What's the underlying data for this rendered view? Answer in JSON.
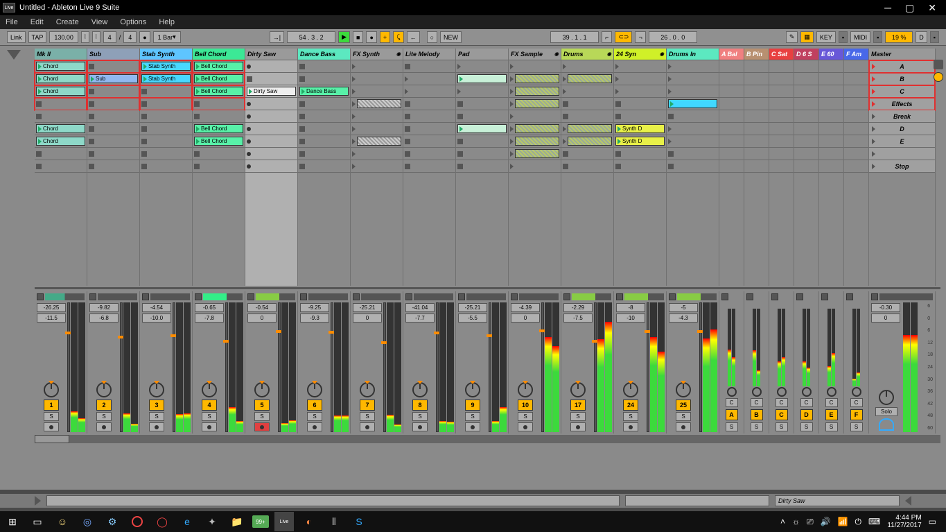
{
  "window": {
    "app_badge": "Live",
    "title": "Untitled - Ableton Live 9 Suite"
  },
  "menu": [
    "File",
    "Edit",
    "Create",
    "View",
    "Options",
    "Help"
  ],
  "transport": {
    "link": "Link",
    "tap": "TAP",
    "tempo": "130.00",
    "sig_num": "4",
    "sig_den": "4",
    "bar_quant": "1 Bar",
    "position": "54 . 3 . 2",
    "new": "NEW",
    "loop_pos": "39 . 1 . 1",
    "loop_len": "26 . 0 . 0",
    "key": "KEY",
    "midi": "MIDI",
    "cpu": "19 %",
    "d": "D"
  },
  "tracks": [
    {
      "name": "Mk II",
      "color": "#7ab0a8",
      "peak": "-26.25",
      "gain": "-11.5",
      "num": "1"
    },
    {
      "name": "Sub",
      "color": "#8ea0b8",
      "peak": "-9.82",
      "gain": "-6.8",
      "num": "2"
    },
    {
      "name": "Stab Synth",
      "color": "#5ec5ff",
      "peak": "-4.54",
      "gain": "-10.0",
      "num": "3"
    },
    {
      "name": "Bell Chord",
      "color": "#3ce896",
      "peak": "-0.65",
      "gain": "-7.8",
      "num": "4"
    },
    {
      "name": "Dirty Saw",
      "color": "#9a9a9a",
      "peak": "-0.54",
      "gain": "0",
      "num": "5"
    },
    {
      "name": "Dance Bass",
      "color": "#5ce8c0",
      "peak": "-9.25",
      "gain": "-9.3",
      "num": "6"
    },
    {
      "name": "FX Synth",
      "color": "#9a9a9a",
      "peak": "-25.21",
      "gain": "0",
      "num": "7"
    },
    {
      "name": "Lite Melody",
      "color": "#9a9a9a",
      "peak": "-41.04",
      "gain": "-7.7",
      "num": "8"
    },
    {
      "name": "Pad",
      "color": "#9a9a9a",
      "peak": "-25.21",
      "gain": "-5.5",
      "num": "9"
    },
    {
      "name": "FX Sample",
      "color": "#9a9a9a",
      "peak": "-4.39",
      "gain": "0",
      "num": "10"
    },
    {
      "name": "Drums",
      "color": "#b8d858",
      "peak": "-2.29",
      "gain": "-7.5",
      "num": "17"
    },
    {
      "name": "24 Syn",
      "color": "#d0f028",
      "peak": "-8",
      "gain": "-10",
      "num": "24"
    },
    {
      "name": "Drums In",
      "color": "#5ce8c0",
      "peak": "-5",
      "gain": "-4.3",
      "num": "25"
    }
  ],
  "returns": [
    {
      "name": "A Bal",
      "color": "#f08080",
      "letter": "A"
    },
    {
      "name": "B Pin",
      "color": "#b89070",
      "letter": "B"
    },
    {
      "name": "C Sat",
      "color": "#e84040",
      "letter": "C"
    },
    {
      "name": "D 6 S",
      "color": "#c04060",
      "letter": "D"
    },
    {
      "name": "E 60",
      "color": "#6858d8",
      "letter": "E"
    },
    {
      "name": "F Am",
      "color": "#4868e8",
      "letter": "F"
    }
  ],
  "master": {
    "name": "Master",
    "peak": "-0.30",
    "gain": "0",
    "solo": "Solo"
  },
  "scenes": [
    "A",
    "B",
    "C",
    "Effects",
    "Break",
    "D",
    "E",
    "",
    "Stop"
  ],
  "clips": {
    "chord": "Chord",
    "sub": "Sub",
    "stab": "Stab Synth",
    "bell": "Bell Chord",
    "saw": "Dirty Saw",
    "bass": "Dance Bass",
    "synthd": "Synth D"
  },
  "clip_colors": {
    "teal": "#8ed8c8",
    "blue": "#90b8f0",
    "cyan": "#48d8ff",
    "mint": "#58f0a8",
    "pale": "#c8f0d8",
    "yellow": "#e8f048",
    "brightcyan": "#40d8ff",
    "white": "#eee"
  },
  "scale": [
    "6",
    "0",
    "6",
    "12",
    "18",
    "24",
    "30",
    "36",
    "42",
    "48",
    "60"
  ],
  "status_clip": "Dirty Saw",
  "buttons": {
    "s": "S",
    "c": "C"
  },
  "taskbar": {
    "time": "4:44 PM",
    "date": "11/27/2017",
    "badge": "99+"
  }
}
